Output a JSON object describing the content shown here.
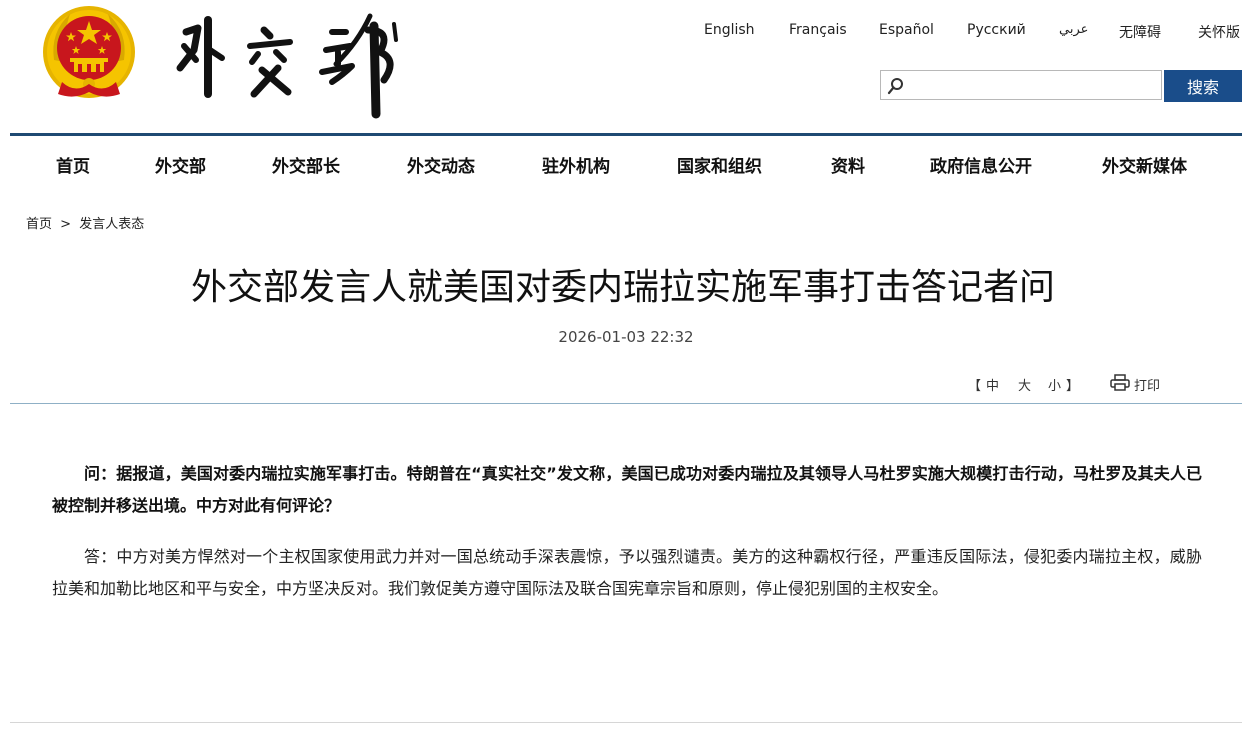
{
  "header": {
    "site_logo_text": "外交部",
    "languages": [
      "English",
      "Français",
      "Español",
      "Русский",
      "عربي",
      "无障碍",
      "关怀版"
    ]
  },
  "search": {
    "placeholder": "",
    "value": "",
    "button_label": "搜索"
  },
  "nav": {
    "items": [
      "首页",
      "外交部",
      "外交部长",
      "外交动态",
      "驻外机构",
      "国家和组织",
      "资料",
      "政府信息公开",
      "外交新媒体"
    ]
  },
  "breadcrumb": {
    "items": [
      "首页",
      "发言人表态"
    ],
    "separator": ">"
  },
  "article": {
    "title": "外交部发言人就美国对委内瑞拉实施军事打击答记者问",
    "date": "2026-01-03 22:32",
    "font_size": {
      "bracket_open": "【",
      "options": [
        "中",
        "大",
        "小"
      ],
      "bracket_close": "】"
    },
    "print_label": "打印",
    "question": "问：据报道，美国对委内瑞拉实施军事打击。特朗普在“真实社交”发文称，美国已成功对委内瑞拉及其领导人马杜罗实施大规模打击行动，马杜罗及其夫人已被控制并移送出境。中方对此有何评论？",
    "answer": "答：中方对美方悍然对一个主权国家使用武力并对一国总统动手深表震惊，予以强烈谴责。美方的这种霸权行径，严重违反国际法，侵犯委内瑞拉主权，威胁拉美和加勒比地区和平与安全，中方坚决反对。我们敦促美方遵守国际法及联合国宪章宗旨和原则，停止侵犯别国的主权安全。"
  },
  "colors": {
    "nav_rule": "#1f4a73",
    "search_button": "#1a4d8a",
    "emblem_red": "#c8161d",
    "emblem_gold": "#f5c400"
  }
}
